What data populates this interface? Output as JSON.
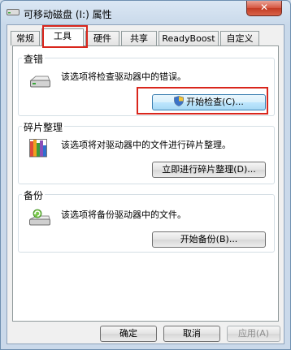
{
  "window": {
    "title": "可移动磁盘 (I:) 属性",
    "close_label": "✕"
  },
  "tabs": [
    {
      "label": "常规"
    },
    {
      "label": "工具"
    },
    {
      "label": "硬件"
    },
    {
      "label": "共享"
    },
    {
      "label": "ReadyBoost"
    },
    {
      "label": "自定义"
    }
  ],
  "active_tab": "工具",
  "sections": {
    "check": {
      "title": "查错",
      "description": "该选项将检查驱动器中的错误。",
      "button": "开始检查(C)..."
    },
    "defrag": {
      "title": "碎片整理",
      "description": "该选项将对驱动器中的文件进行碎片整理。",
      "button": "立即进行碎片整理(D)..."
    },
    "backup": {
      "title": "备份",
      "description": "该选项将备份驱动器中的文件。",
      "button": "开始备份(B)..."
    }
  },
  "footer": {
    "ok": "确定",
    "cancel": "取消",
    "apply": "应用(A)"
  },
  "colors": {
    "highlight": "#d9261c",
    "accent": "#3c7fb1"
  },
  "icons": {
    "title": "drive-icon",
    "check": "drive-icon",
    "defrag": "defrag-icon",
    "backup": "backup-icon",
    "check_button": "shield-icon"
  }
}
